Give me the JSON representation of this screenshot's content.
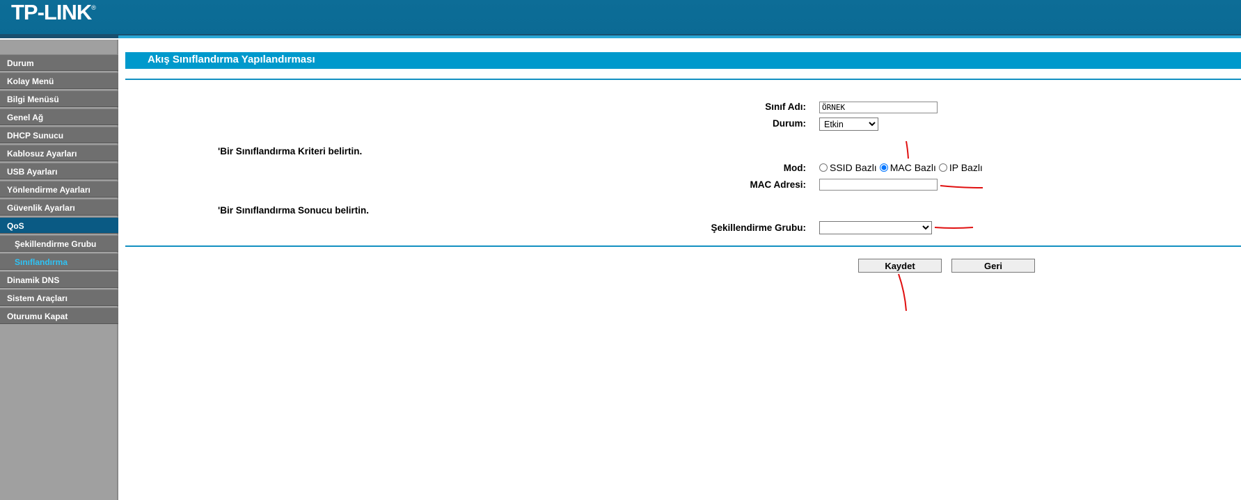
{
  "header": {
    "logo": "TP-LINK",
    "logo_mark": "®"
  },
  "sidebar": {
    "items": [
      {
        "label": "Durum"
      },
      {
        "label": "Kolay Menü"
      },
      {
        "label": "Bilgi Menüsü"
      },
      {
        "label": "Genel Ağ"
      },
      {
        "label": "DHCP Sunucu"
      },
      {
        "label": "Kablosuz Ayarları"
      },
      {
        "label": "USB Ayarları"
      },
      {
        "label": "Yönlendirme Ayarları"
      },
      {
        "label": "Güvenlik Ayarları"
      },
      {
        "label": "QoS"
      },
      {
        "label": "Şekillendirme Grubu"
      },
      {
        "label": "Sınıflandırma"
      },
      {
        "label": "Dinamik DNS"
      },
      {
        "label": "Sistem Araçları"
      },
      {
        "label": "Oturumu Kapat"
      }
    ]
  },
  "main": {
    "title": "Akış Sınıflandırma Yapılandırması",
    "class_name_label": "Sınıf Adı:",
    "class_name_value": "ÖRNEK",
    "status_label": "Durum:",
    "status_value": "Etkin",
    "criteria_note": "'Bir Sınıflandırma Kriteri belirtin.",
    "mode_label": "Mod:",
    "mode_options": [
      "SSID Bazlı",
      "MAC Bazlı",
      "IP Bazlı"
    ],
    "mode_selected": "MAC Bazlı",
    "mac_label": "MAC Adresi:",
    "mac_value": "",
    "result_note": "'Bir Sınıflandırma Sonucu belirtin.",
    "group_label": "Şekillendirme Grubu:",
    "group_value": "",
    "save_label": "Kaydet",
    "back_label": "Geri"
  },
  "colors": {
    "header": "#0b6a94",
    "accent": "#0099cc",
    "annotation": "#e01010"
  }
}
